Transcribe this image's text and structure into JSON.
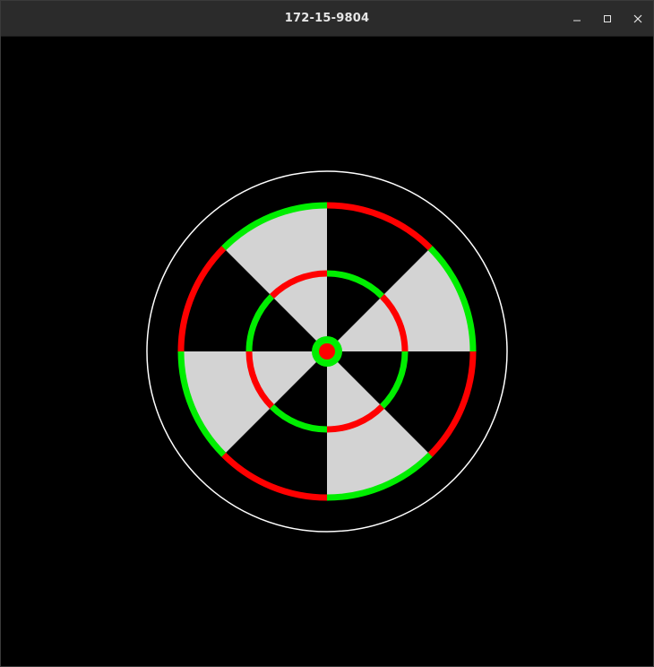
{
  "window": {
    "title": "172-15-9804",
    "controls": [
      {
        "name": "minimize-icon",
        "icon": "minimize"
      },
      {
        "name": "maximize-icon",
        "icon": "maximize"
      },
      {
        "name": "close-icon",
        "icon": "close"
      }
    ]
  },
  "target": {
    "sectors": 8,
    "colors": {
      "sector_light": "#d3d3d3",
      "sector_dark": "#000000",
      "green": "#00ee00",
      "red": "#ff0000",
      "outline": "#ffffff",
      "background": "#000000"
    }
  }
}
